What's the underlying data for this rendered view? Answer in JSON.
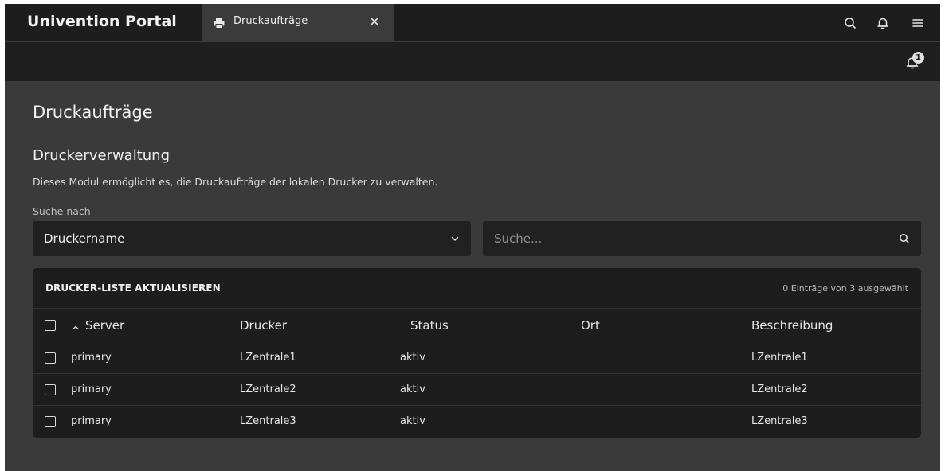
{
  "app": {
    "brand": "Univention Portal",
    "tab_label": "Druckaufträge",
    "notification_count": "1"
  },
  "page": {
    "title": "Druckaufträge",
    "section_title": "Druckerverwaltung",
    "description": "Dieses Modul ermöglicht es, die Druckaufträge der lokalen Drucker zu verwalten."
  },
  "search": {
    "label": "Suche nach",
    "selected": "Druckername",
    "placeholder": "Suche..."
  },
  "grid": {
    "refresh_label": "DRUCKER-LISTE AKTUALISIEREN",
    "selection_info": "0 Einträge von 3 ausgewählt",
    "columns": [
      "Server",
      "Drucker",
      "Status",
      "Ort",
      "Beschreibung"
    ],
    "rows": [
      {
        "server": "primary",
        "printer": "LZentrale1",
        "status": "aktiv",
        "location": "",
        "description": "LZentrale1"
      },
      {
        "server": "primary",
        "printer": "LZentrale2",
        "status": "aktiv",
        "location": "",
        "description": "LZentrale2"
      },
      {
        "server": "primary",
        "printer": "LZentrale3",
        "status": "aktiv",
        "location": "",
        "description": "LZentrale3"
      }
    ]
  },
  "icons": {
    "tab": "printer-icon",
    "close": "close-icon",
    "search": "search-icon",
    "bell": "bell-icon",
    "menu": "menu-icon",
    "chevron": "chevron-down-icon",
    "sort": "sort-ascending-icon"
  }
}
